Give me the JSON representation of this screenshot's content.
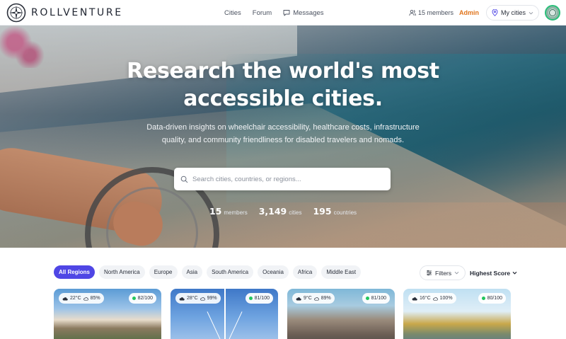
{
  "brand": {
    "name": "ROLLVENTURE"
  },
  "nav": {
    "links": [
      "Cities",
      "Forum",
      "Messages"
    ],
    "members": "15 members",
    "admin": "Admin",
    "my_cities": "My cities"
  },
  "hero": {
    "title_line1": "Research the world's most",
    "title_line2": "accessible cities.",
    "subtitle": "Data-driven insights on wheelchair accessibility, healthcare costs, infrastructure quality, and community friendliness for disabled travelers and nomads.",
    "search_placeholder": "Search cities, countries, or regions...",
    "stats": [
      {
        "value": "15",
        "label": "members"
      },
      {
        "value": "3,149",
        "label": "cities"
      },
      {
        "value": "195",
        "label": "countries"
      }
    ]
  },
  "filters": {
    "regions": [
      "All Regions",
      "North America",
      "Europe",
      "Asia",
      "South America",
      "Oceania",
      "Africa",
      "Middle East"
    ],
    "active_region": "All Regions",
    "filters_label": "Filters",
    "sort_label": "Highest Score"
  },
  "cards": [
    {
      "temp": "22°C",
      "humidity": "85%",
      "score": "82/100"
    },
    {
      "temp": "28°C",
      "humidity": "99%",
      "score": "81/100"
    },
    {
      "temp": "9°C",
      "humidity": "89%",
      "score": "81/100"
    },
    {
      "temp": "16°C",
      "humidity": "100%",
      "score": "80/100"
    }
  ],
  "colors": {
    "accent": "#4f46e5",
    "admin": "#e0751d",
    "score_dot": "#22c55e"
  }
}
